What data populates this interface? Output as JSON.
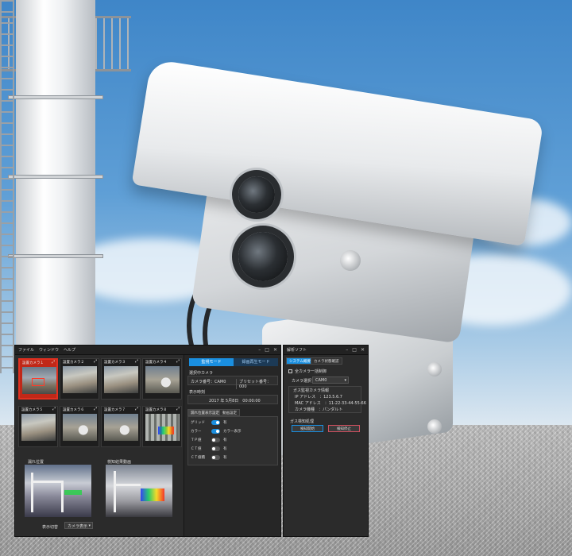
{
  "main_window": {
    "menu": [
      "ファイル",
      "ウィンドウ",
      "ヘルプ"
    ],
    "cameras": [
      {
        "label": "設置カメラ１",
        "active": true
      },
      {
        "label": "設置カメラ２",
        "active": false
      },
      {
        "label": "設置カメラ３",
        "active": false
      },
      {
        "label": "設置カメラ４",
        "active": false
      },
      {
        "label": "設置カメラ５",
        "active": false
      },
      {
        "label": "設置カメラ６",
        "active": false
      },
      {
        "label": "設置カメラ７",
        "active": false
      },
      {
        "label": "設置カメラ８",
        "active": false
      }
    ],
    "view_left_label": "漏れ位置",
    "view_right_label": "検知結果動画",
    "display_select_label": "表示切替",
    "display_select_value": "カメラ表示",
    "mode_monitor": "監視モード",
    "mode_record": "録画再生モード",
    "selected_camera_title": "選択中カメラ",
    "camera_no": "カメラ番号：CAM0",
    "preset_no": "プリセット番号：000",
    "display_time_title": "表示時刻",
    "display_time": "2017 年 5月8日　00:00:00",
    "tab_leak_display": "漏れ位置表示設定",
    "tab_video_settings": "動画設定",
    "toggles": [
      {
        "label": "グリッド",
        "state": "有",
        "on": true
      },
      {
        "label": "カラー",
        "state": "カラー表示",
        "on": true
      },
      {
        "label": "ＴＰ値",
        "state": "有",
        "on": false
      },
      {
        "label": "ＣＴ値",
        "state": "有",
        "on": false
      },
      {
        "label": "ＣＴ値積",
        "state": "有",
        "on": false
      }
    ]
  },
  "side_window": {
    "title": "解析ソフト",
    "tab_system": "システム概要",
    "tab_camera_status": "カメラ状態確認",
    "all_camera_label": "全カメラ一括制御",
    "camera_select_label": "カメラ選択",
    "camera_select_value": "CAM0",
    "info_title": "ガス監視カメラ情報",
    "ip_label": "IP アドレス　：123.5.6.7",
    "mac_label": "MAC アドレス　：11-22-33-44-55-66",
    "model_label": "カメラ機種　：パンダルト",
    "control_title": "ガス検知処理",
    "start_button": "検知開始",
    "stop_button": "検知停止"
  }
}
